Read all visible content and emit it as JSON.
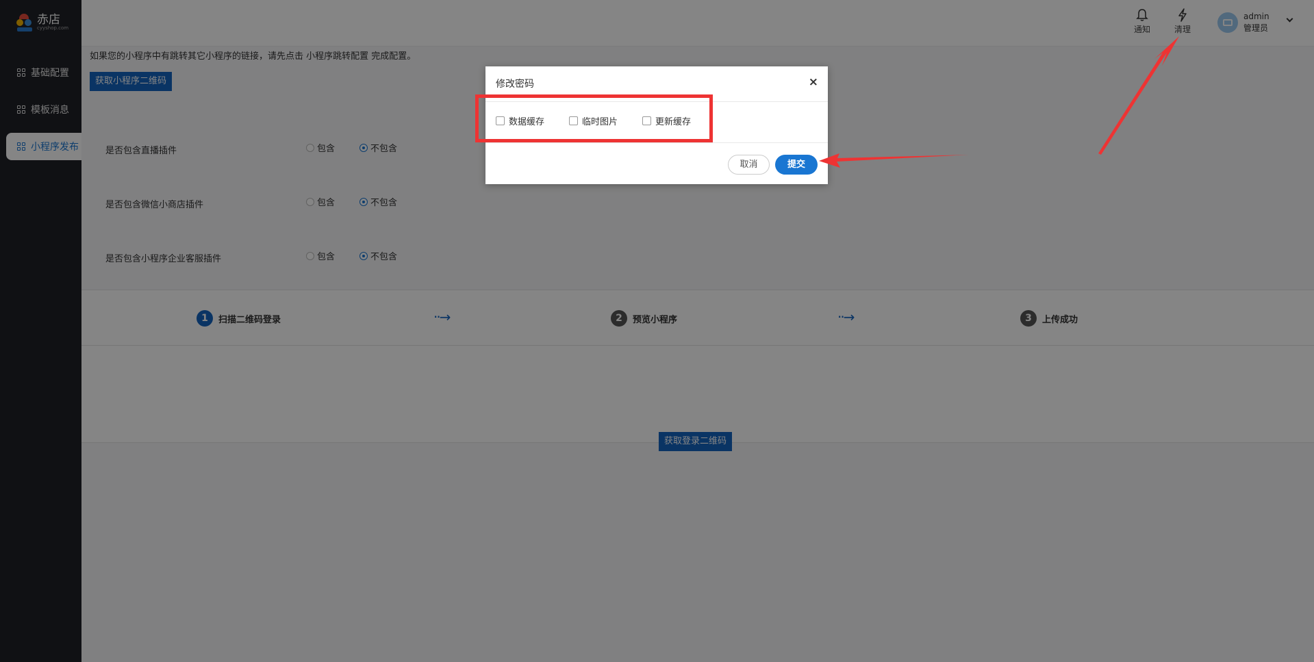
{
  "sidebar": {
    "logo_text": "赤店",
    "logo_sub": "cyyshop.com",
    "items": [
      {
        "label": "基础配置"
      },
      {
        "label": "模板消息"
      },
      {
        "label": "小程序发布"
      }
    ]
  },
  "header": {
    "notify_label": "通知",
    "clean_label": "清理",
    "user_name": "admin",
    "user_role": "管理员"
  },
  "main": {
    "tip": "如果您的小程序中有跳转其它小程序的链接，请先点击 小程序跳转配置 完成配置。",
    "get_qr_button": "获取小程序二维码",
    "option_yes": "包含",
    "option_no": "不包含",
    "rows": [
      {
        "label": "是否包含直播插件"
      },
      {
        "label": "是否包含微信小商店插件"
      },
      {
        "label": "是否包含小程序企业客服插件"
      }
    ],
    "steps": [
      {
        "num": "1",
        "label": "扫描二维码登录"
      },
      {
        "num": "2",
        "label": "预览小程序"
      },
      {
        "num": "3",
        "label": "上传成功"
      }
    ],
    "login_qr_button": "获取登录二维码"
  },
  "modal": {
    "title": "修改密码",
    "close": "×",
    "checkboxes": [
      {
        "label": "数据缓存"
      },
      {
        "label": "临时图片"
      },
      {
        "label": "更新缓存"
      }
    ],
    "cancel_label": "取消",
    "submit_label": "提交"
  },
  "colors": {
    "primary": "#1976d2",
    "sidebar_bg": "#1f2128",
    "annotation_red": "#ee3333"
  }
}
